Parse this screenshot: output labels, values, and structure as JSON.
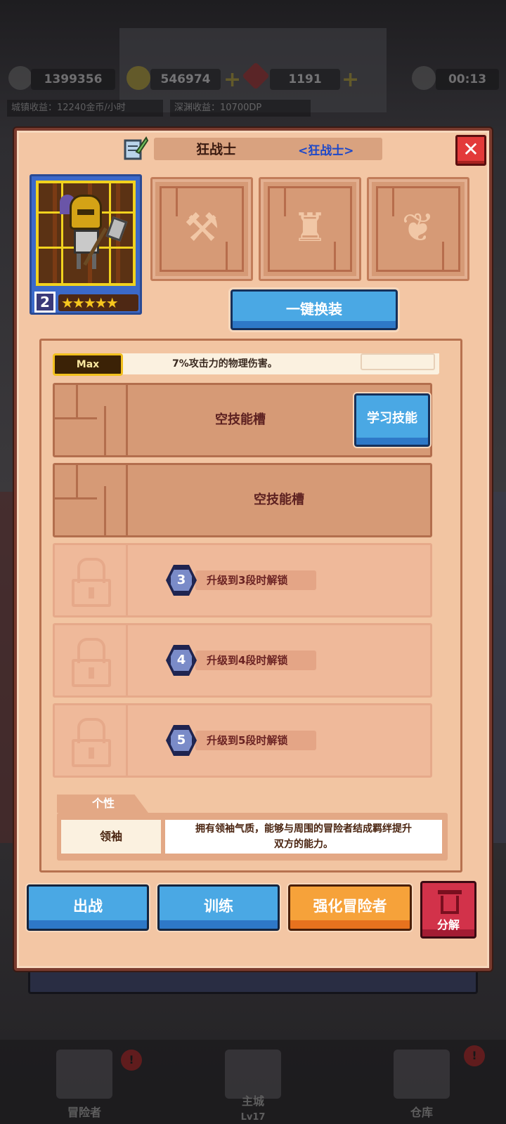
{
  "hud": {
    "stat1": "1399356",
    "gold": "546974",
    "gems": "1191",
    "timer": "00:13",
    "town_income": "城镇收益：12240金币/小时",
    "abyss_income": "深渊收益：10700DP"
  },
  "panel": {
    "hero_name": "狂战士",
    "hero_class": "<狂战士>",
    "close_label": "✕",
    "level": "2",
    "stars": "★★★★★",
    "equip_all_label": "一键换装",
    "equip_slots": [
      {
        "icon": "axe-icon",
        "glyph": "⚒"
      },
      {
        "icon": "armor-icon",
        "glyph": "♜"
      },
      {
        "icon": "accessory-icon",
        "glyph": "❦"
      }
    ]
  },
  "skills": {
    "max_badge": "Max",
    "partial_text": "7%攻击力的物理伤害。",
    "empty_slot_label": "空技能槽",
    "learn_label": "学习技能",
    "locked": [
      {
        "stage": "3",
        "text": "升级到3段时解锁"
      },
      {
        "stage": "4",
        "text": "升级到4段时解锁"
      },
      {
        "stage": "5",
        "text": "升级到5段时解锁"
      }
    ]
  },
  "trait": {
    "tab_label": "个性",
    "name": "领袖",
    "desc_line1": "拥有领袖气质，能够与周围的冒险者结成羁绊提升",
    "desc_line2": "双方的能力。"
  },
  "actions": {
    "deploy": "出战",
    "train": "训练",
    "enhance": "强化冒险者",
    "dismantle": "分解"
  },
  "bottom_nav": {
    "adventurers": "冒险者",
    "main_city": "主城",
    "main_city_level": "Lv17",
    "warehouse": "仓库",
    "badge": "!"
  },
  "colors": {
    "panel_bg": "#f3c6a4",
    "blue_button": "#4aa8e4",
    "orange_button": "#f6a23a",
    "close_red": "#e33a3a",
    "class_blue": "#1e48c8"
  }
}
